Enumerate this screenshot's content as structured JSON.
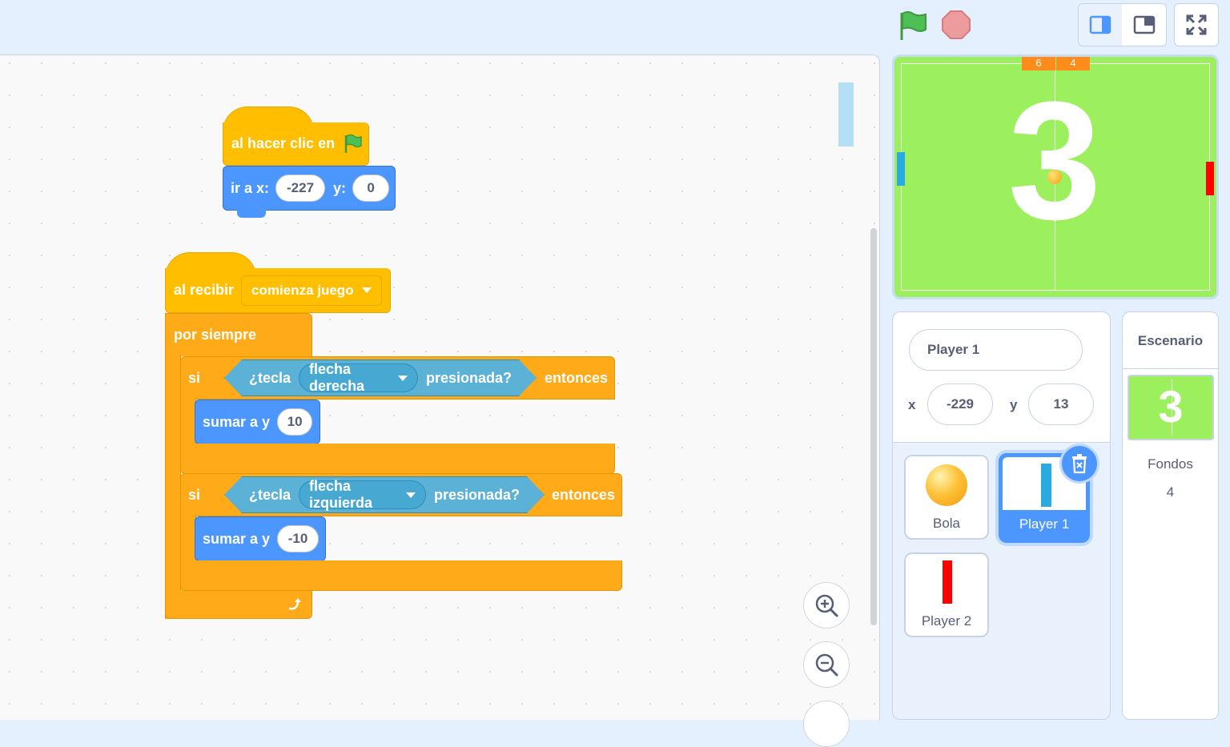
{
  "colors": {
    "events": "#ffbf00",
    "control": "#ffab19",
    "motion": "#4c97ff",
    "sensing": "#5cb1d6",
    "stage_bg": "#9cf05d",
    "accent": "#4c97ff",
    "player1": "#29abe2",
    "player2": "#ff0000"
  },
  "toolbar": {
    "green_flag_icon": "green-flag-icon",
    "stop_icon": "stop-icon",
    "small_stage_icon": "small-stage-icon",
    "normal_stage_icon": "normal-stage-icon",
    "fullscreen_icon": "fullscreen-icon"
  },
  "scripts": {
    "script1": {
      "hat_label": "al hacer clic en",
      "goto_label": "ir a x:",
      "x_value": "-227",
      "y_label": "y:",
      "y_value": "0"
    },
    "script2": {
      "hat_label": "al recibir",
      "message": "comienza juego",
      "forever_label": "por siempre",
      "if1": {
        "si": "si",
        "tecla": "¿tecla",
        "key": "flecha derecha",
        "presionada": "presionada?",
        "entonces": "entonces",
        "change_label": "sumar a y",
        "change_value": "10"
      },
      "if2": {
        "si": "si",
        "tecla": "¿tecla",
        "key": "flecha izquierda",
        "presionada": "presionada?",
        "entonces": "entonces",
        "change_label": "sumar a y",
        "change_value": "-10"
      }
    }
  },
  "stage": {
    "score_left": "6",
    "score_right": "4",
    "countdown": "3"
  },
  "sprite_info": {
    "name": "Player 1",
    "x_label": "x",
    "x_value": "-229",
    "y_label": "y",
    "y_value": "13"
  },
  "sprites": [
    {
      "name": "Bola"
    },
    {
      "name": "Player 1"
    },
    {
      "name": "Player 2"
    }
  ],
  "backdrop": {
    "title": "Escenario",
    "thumb_text": "3",
    "label": "Fondos",
    "count": "4"
  }
}
